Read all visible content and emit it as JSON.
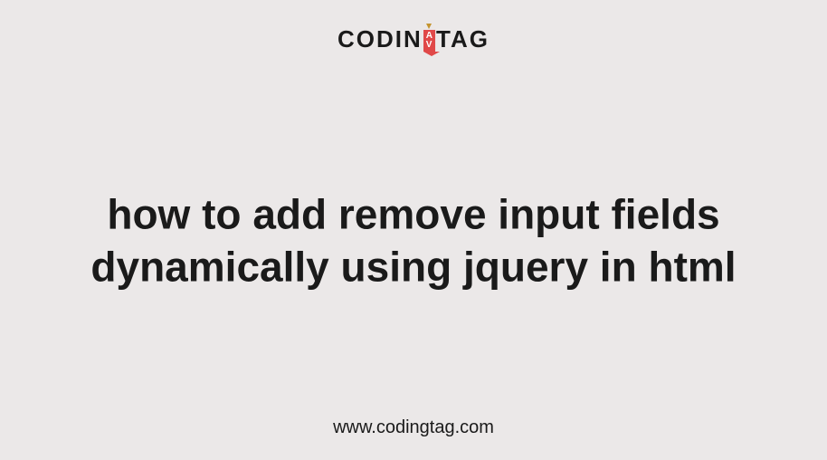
{
  "logo": {
    "first": "CODIN",
    "middle": "A\nV",
    "last": "TAG"
  },
  "headline": "how to add remove input fields dynamically using jquery in html",
  "footer_url": "www.codingtag.com"
}
